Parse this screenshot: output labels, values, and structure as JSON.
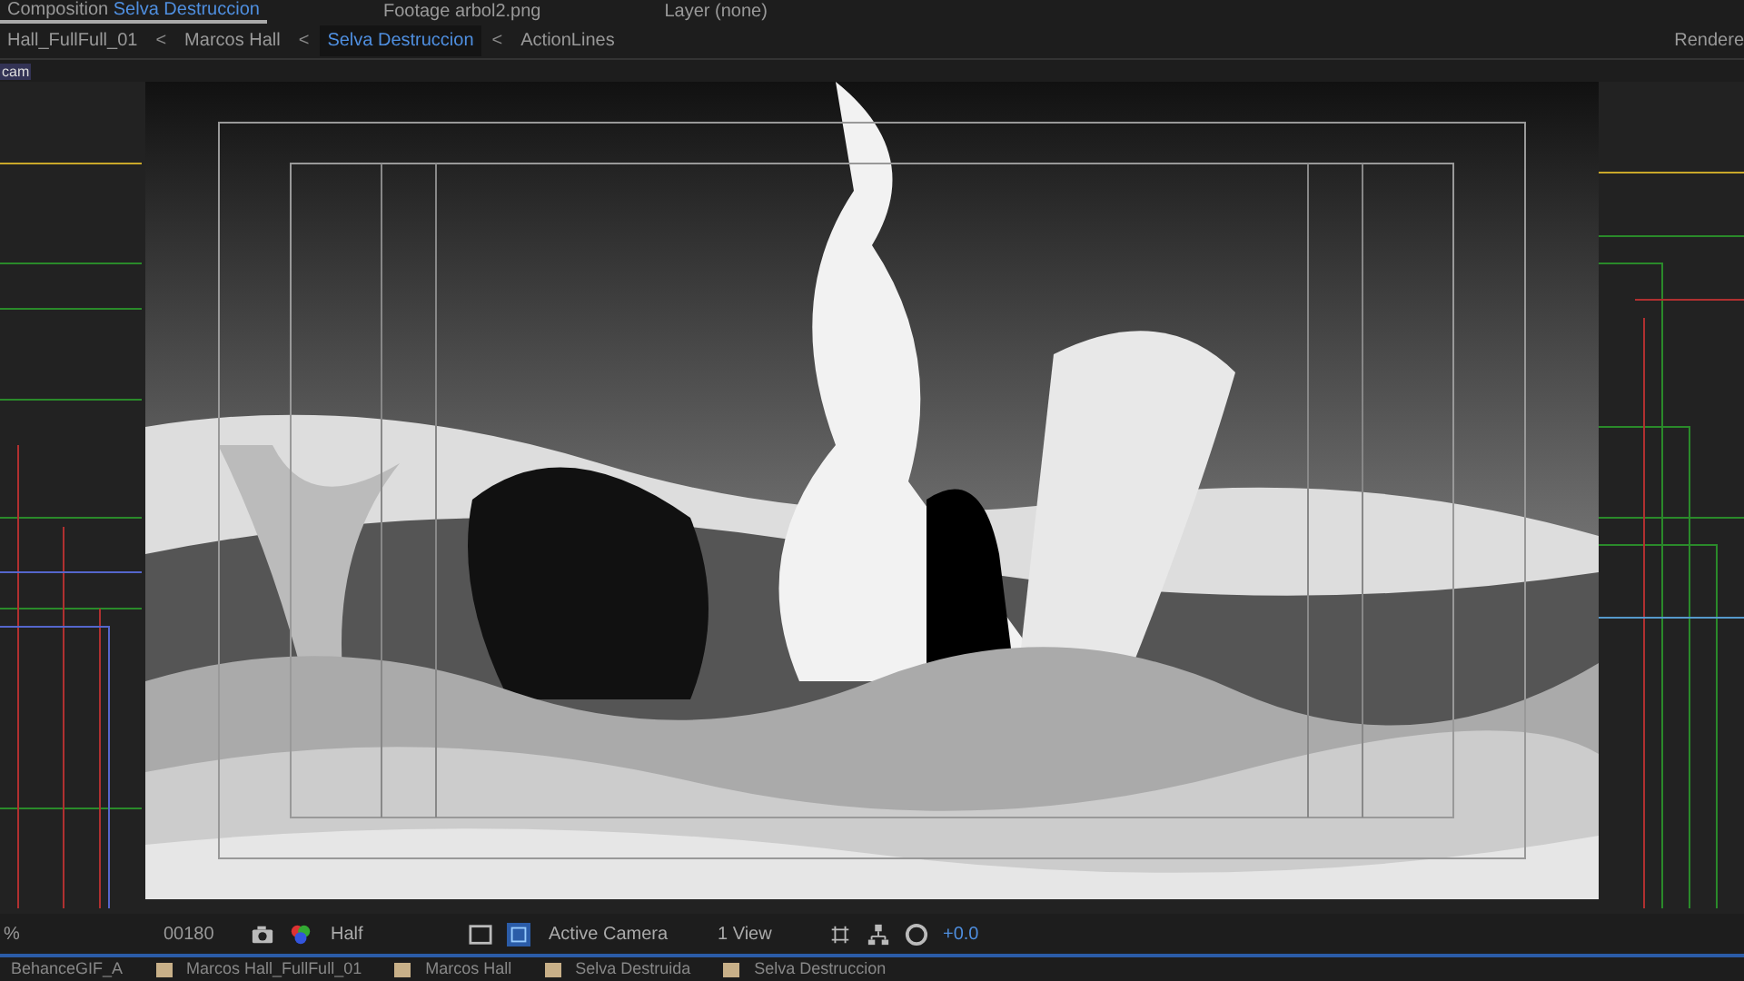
{
  "panel_tabs": [
    {
      "label": "Composition",
      "value": "Selva Destruccion",
      "selected": true
    },
    {
      "label": "Footage",
      "value": "arbol2.png",
      "selected": false
    },
    {
      "label": "Layer",
      "value": "(none)",
      "selected": false
    }
  ],
  "breadcrumbs": [
    {
      "label": "Hall_FullFull_01",
      "selected": false
    },
    {
      "label": "Marcos Hall",
      "selected": false
    },
    {
      "label": "Selva Destruccion",
      "selected": true
    },
    {
      "label": "ActionLines",
      "selected": false
    }
  ],
  "breadcrumb_separator": "<",
  "renderer": "Rendere",
  "camera_label": "cam",
  "toolbar": {
    "zoom": "%",
    "timecode": "00180",
    "resolution": "Half",
    "camera": "Active Camera",
    "views": "1 View",
    "exposure": "+0.0"
  },
  "bottom_tabs": [
    {
      "label": "BehanceGIF_A"
    },
    {
      "label": "Marcos Hall_FullFull_01",
      "color": "#c8b088"
    },
    {
      "label": "Marcos Hall",
      "color": "#c8b088"
    },
    {
      "label": "Selva Destruida",
      "color": "#c8b088"
    },
    {
      "label": "Selva Destruccion",
      "color": "#c8b088"
    }
  ]
}
